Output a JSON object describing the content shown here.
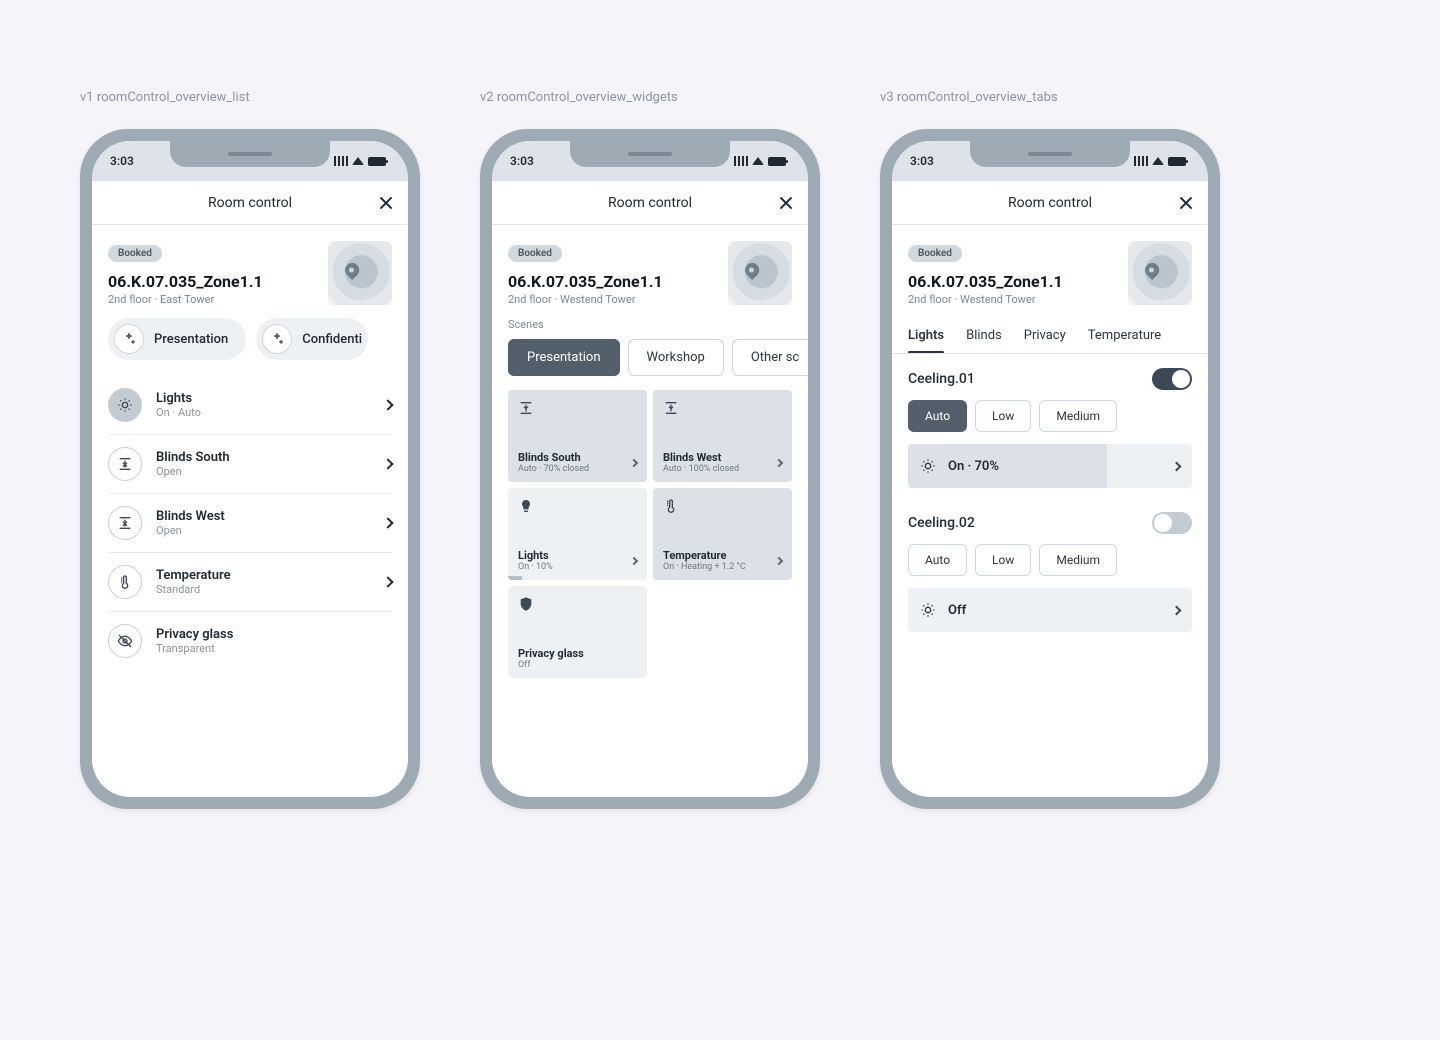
{
  "labels": {
    "v1": "v1 roomControl_overview_list",
    "v2": "v2 roomControl_overview_widgets",
    "v3": "v3 roomControl_overview_tabs"
  },
  "status_time": "3:03",
  "header_title": "Room control",
  "badge": "Booked",
  "room": {
    "name": "06.K.07.035_Zone1.1",
    "sub_v1": "2nd floor · East Tower",
    "sub_v2": "2nd floor · Westend Tower",
    "sub_v3": "2nd floor · Westend Tower"
  },
  "v1": {
    "chips": [
      {
        "label": "Presentation"
      },
      {
        "label": "Confidenti"
      }
    ],
    "rows": [
      {
        "title": "Lights",
        "sub": "On · Auto",
        "active": true
      },
      {
        "title": "Blinds South",
        "sub": "Open"
      },
      {
        "title": "Blinds West",
        "sub": "Open"
      },
      {
        "title": "Temperature",
        "sub": "Standard"
      },
      {
        "title": "Privacy glass",
        "sub": "Transparent"
      }
    ]
  },
  "v2": {
    "section": "Scenes",
    "tabs": [
      {
        "label": "Presentation",
        "active": true
      },
      {
        "label": "Workshop"
      },
      {
        "label": "Other sc"
      }
    ],
    "widgets": [
      {
        "title": "Blinds South",
        "sub": "Auto · 70% closed"
      },
      {
        "title": "Blinds West",
        "sub": "Auto · 100% closed"
      },
      {
        "title": "Lights",
        "sub": "On · 10%"
      },
      {
        "title": "Temperature",
        "sub": "On · Heating + 1.2 °C"
      },
      {
        "title": "Privacy glass",
        "sub": "Off"
      }
    ]
  },
  "v3": {
    "tabs": [
      {
        "label": "Lights",
        "active": true
      },
      {
        "label": "Blinds"
      },
      {
        "label": "Privacy"
      },
      {
        "label": "Temperature"
      }
    ],
    "groups": [
      {
        "title": "Ceeling.01",
        "on": true,
        "seg": [
          {
            "label": "Auto",
            "active": true
          },
          {
            "label": "Low"
          },
          {
            "label": "Medium"
          }
        ],
        "status": "On · 70%",
        "progress": 70
      },
      {
        "title": "Ceeling.02",
        "on": false,
        "seg": [
          {
            "label": "Auto"
          },
          {
            "label": "Low"
          },
          {
            "label": "Medium"
          }
        ],
        "status": "Off",
        "progress": 0
      }
    ]
  }
}
